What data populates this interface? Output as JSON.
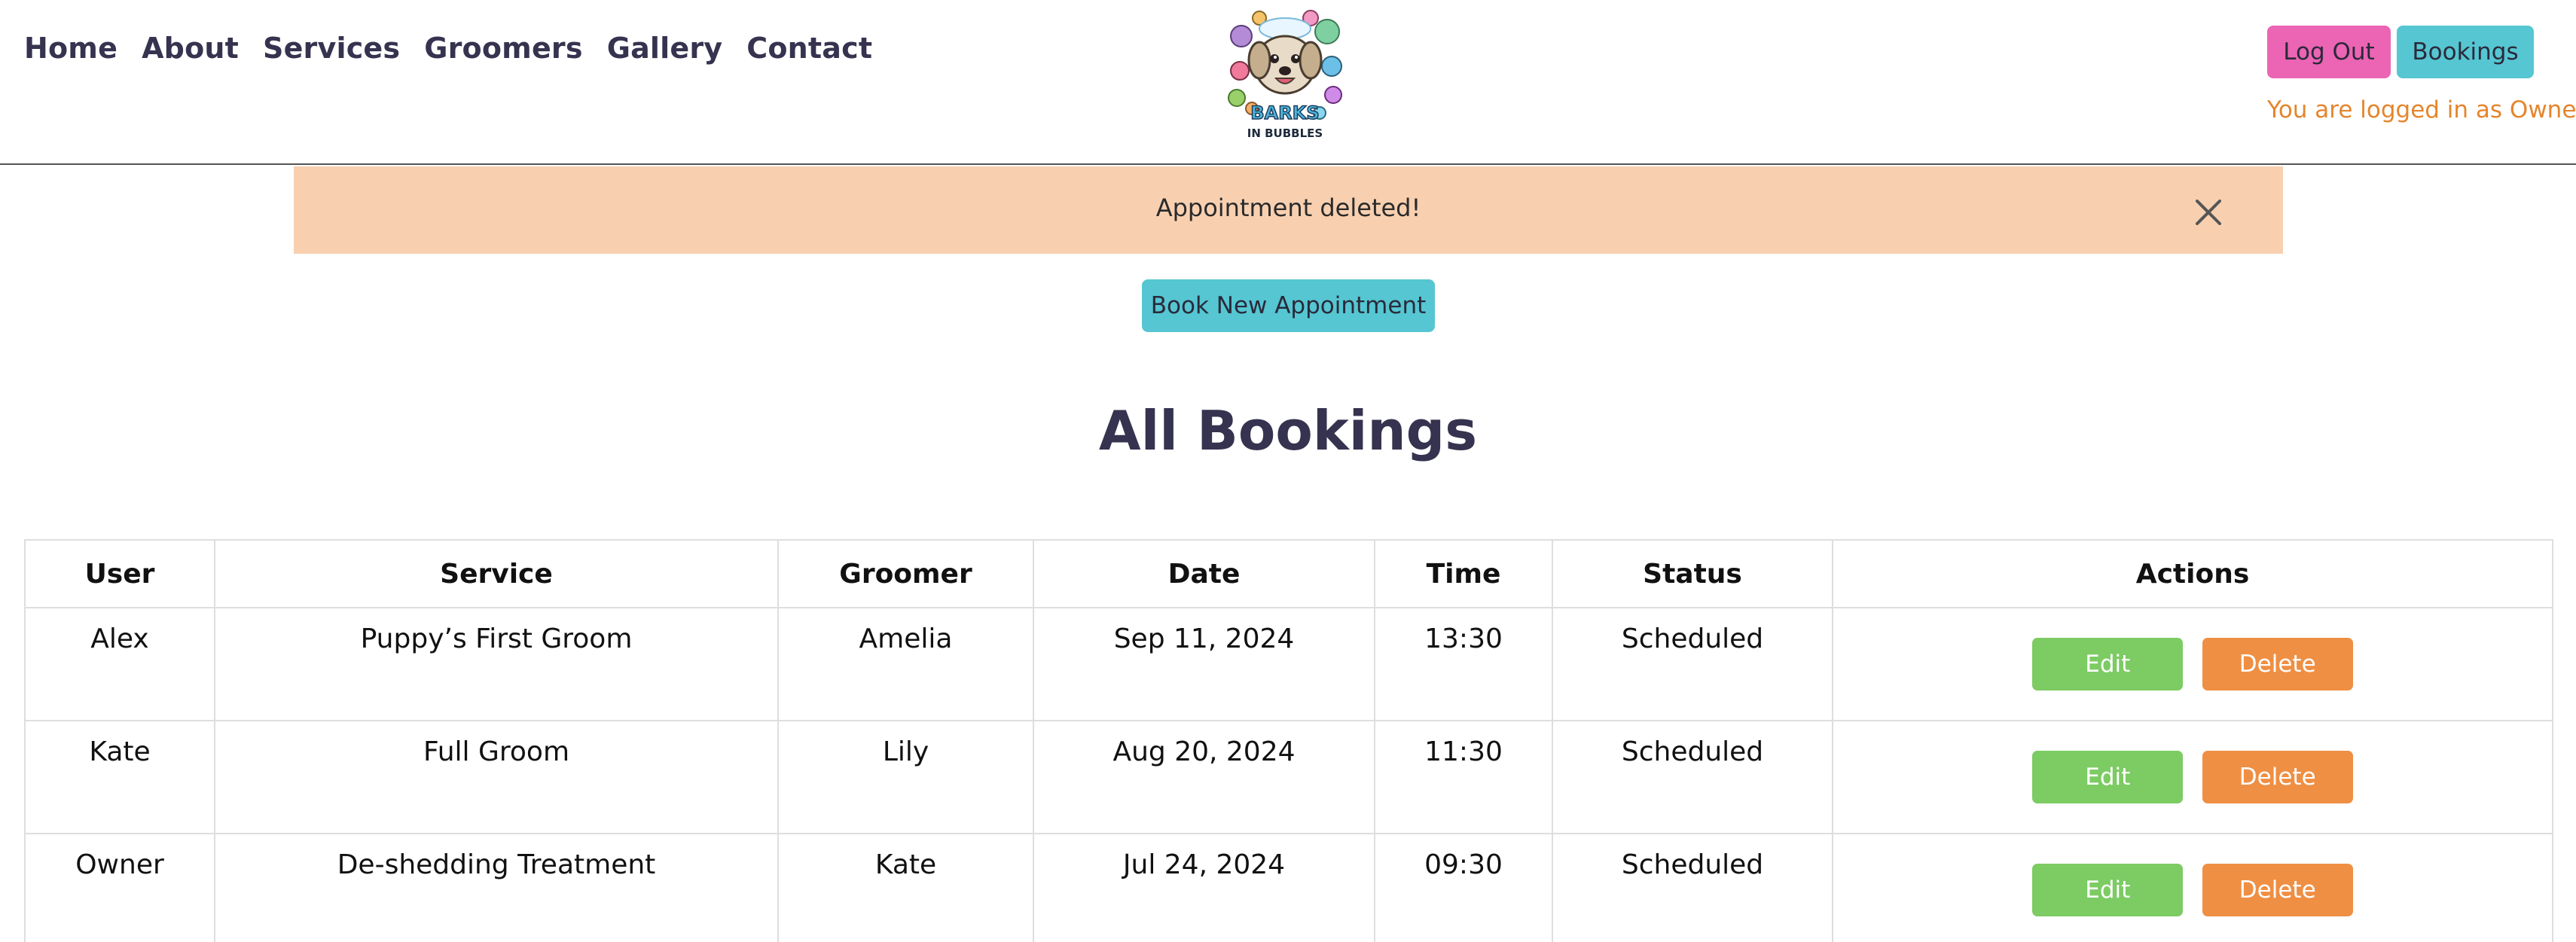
{
  "nav": {
    "items": [
      "Home",
      "About",
      "Services",
      "Groomers",
      "Gallery",
      "Contact"
    ]
  },
  "logo": {
    "text_line1": "BARKS",
    "text_line2": "IN BUBBLES",
    "icon": "dog-bubbles-logo"
  },
  "header": {
    "logout_label": "Log Out",
    "bookings_label": "Bookings",
    "logged_in_text": "You are logged in as Owner"
  },
  "alert": {
    "message": "Appointment deleted!",
    "close_icon": "close-icon"
  },
  "book_button_label": "Book New Appointment",
  "page_title": "All Bookings",
  "table": {
    "headers": [
      "User",
      "Service",
      "Groomer",
      "Date",
      "Time",
      "Status",
      "Actions"
    ],
    "rows": [
      {
        "user": "Alex",
        "service": "Puppy’s First Groom",
        "groomer": "Amelia",
        "date": "Sep 11, 2024",
        "time": "13:30",
        "status": "Scheduled"
      },
      {
        "user": "Kate",
        "service": "Full Groom",
        "groomer": "Lily",
        "date": "Aug 20, 2024",
        "time": "11:30",
        "status": "Scheduled"
      },
      {
        "user": "Owner",
        "service": "De-shedding Treatment",
        "groomer": "Kate",
        "date": "Jul 24, 2024",
        "time": "09:30",
        "status": "Scheduled"
      }
    ],
    "edit_label": "Edit",
    "delete_label": "Delete"
  },
  "colors": {
    "accent_pink": "#ec64b4",
    "accent_cyan": "#55c6d2",
    "alert_bg": "#f8d0b0",
    "edit_green": "#7ccb63",
    "delete_orange": "#ef8f43",
    "owner_text": "#e5852c",
    "heading": "#35334f"
  }
}
